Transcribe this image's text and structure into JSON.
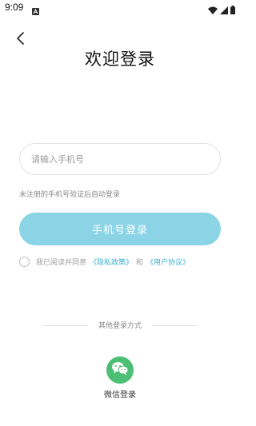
{
  "status_bar": {
    "time": "9:09",
    "icons": [
      "a-notification-icon",
      "wifi-icon",
      "signal-icon",
      "battery-icon"
    ]
  },
  "header": {
    "back_icon": "chevron-left-icon",
    "title": "欢迎登录"
  },
  "phone_input": {
    "placeholder": "请输入手机号",
    "value": ""
  },
  "hint": "未注册的手机号验证后自动登录",
  "login_button": {
    "label": "手机号登录",
    "color": "#8ad4e6"
  },
  "agreement": {
    "prefix": "我已阅读并同意",
    "privacy_link": "《隐私政策》",
    "and": "和",
    "user_link": "《用户协议》",
    "link_color": "#3bb1cf"
  },
  "other_login": {
    "divider_text": "其他登录方式",
    "wechat_icon": "wechat-icon",
    "wechat_label": "微信登录",
    "wechat_color": "#4bbf73"
  }
}
